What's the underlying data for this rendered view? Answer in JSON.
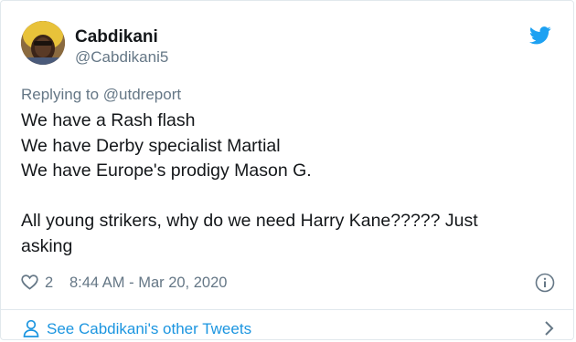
{
  "tweet": {
    "author": {
      "display_name": "Cabdikani",
      "handle": "@Cabdikani5"
    },
    "replying_prefix": "Replying to ",
    "replying_to": "@utdreport",
    "lines": [
      "We have a Rash flash",
      "We have Derby specialist Martial",
      "We have Europe's prodigy Mason G.",
      "",
      "All young strikers, why do we need Harry Kane????? Just",
      "asking"
    ],
    "like_count": "2",
    "timestamp": "8:44 AM - Mar 20, 2020"
  },
  "footer": {
    "link_label": "See Cabdikani's other Tweets"
  },
  "colors": {
    "twitter_blue": "#1da1f2",
    "link_blue": "#1b95e0",
    "muted_gray": "#657786",
    "text": "#14171a",
    "border": "#e1e8ed"
  },
  "icons": {
    "brand": "twitter-bird-icon",
    "like": "heart-icon",
    "info": "info-icon",
    "profile": "person-icon",
    "navigate": "chevron-right-icon"
  }
}
